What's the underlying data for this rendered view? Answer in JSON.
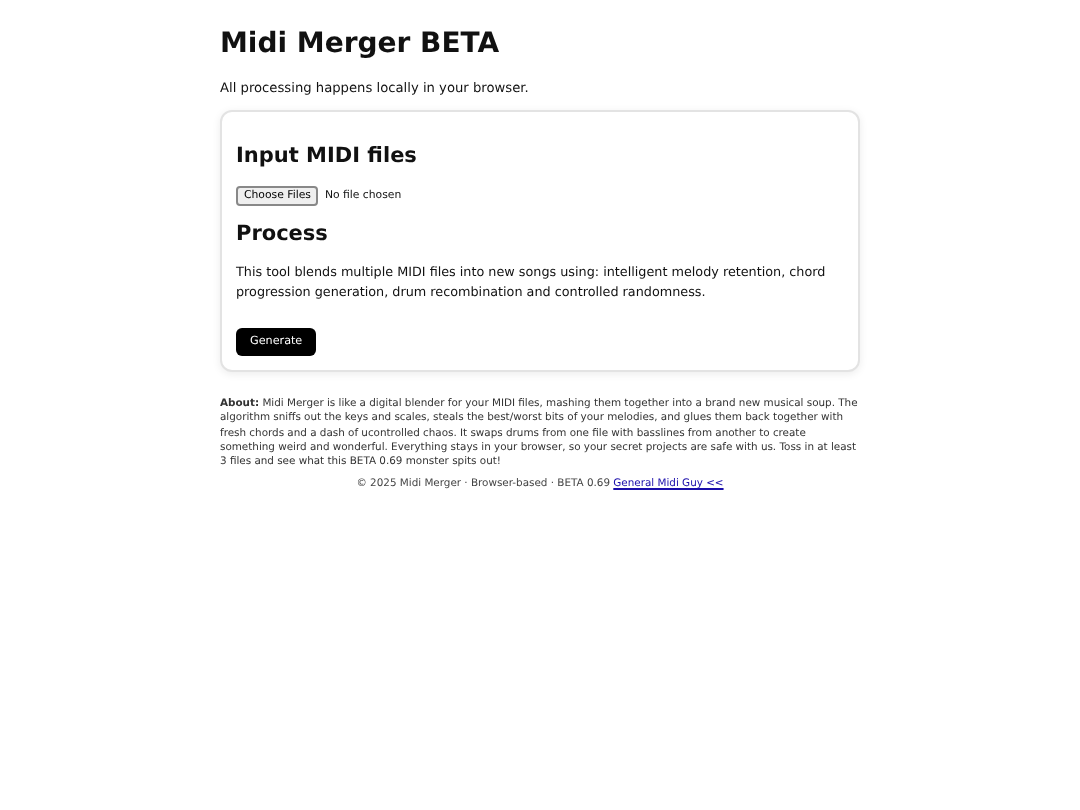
{
  "title": "Midi Merger BETA",
  "subtitle": "All processing happens locally in your browser.",
  "input_section": {
    "heading": "Input MIDI files",
    "file_button": "Choose Files",
    "file_status": "No file chosen"
  },
  "process_section": {
    "heading": "Process",
    "description": "This tool blends multiple MIDI files into new songs using: intelligent melody retention, chord progression generation, drum recombination and controlled randomness.",
    "button": "Generate"
  },
  "about": "**About:** Midi Merger is like a digital blender for your MIDI files, mashing them together into a brand new musical soup. The algorithm sniffs out the keys and scales, steals the best/worst bits of your melodies, and glues them back together with fresh chords and a dash of ucontrolled chaos. It swaps drums from one file with basslines from another to create something weird and wonderful. Everything stays in your browser, so your secret projects are safe with us. Toss in at least 3 files and see what this BETA 0.69 monster spits out!",
  "footer": {
    "text": "© 2025 Midi Merger · Browser-based · BETA 0.69",
    "link": "General Midi Guy <<"
  }
}
